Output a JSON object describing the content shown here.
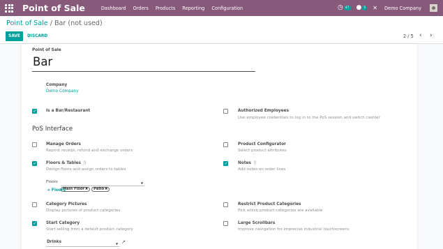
{
  "navbar": {
    "brand": "Point of Sale",
    "menu": [
      "Dashboard",
      "Orders",
      "Products",
      "Reporting",
      "Configuration"
    ],
    "activity_count": "47",
    "message_count": "5",
    "company": "Demo Company",
    "color": "#875a7b"
  },
  "control": {
    "breadcrumb_parent": "Point of Sale",
    "breadcrumb_separator": "/",
    "breadcrumb_current": "Bar (not used)",
    "save_label": "SAVE",
    "discard_label": "DISCARD",
    "pager": "2 / 5",
    "accent": "#00a09d"
  },
  "form": {
    "header_label": "Point of Sale",
    "name": "Bar",
    "company_label": "Company",
    "company_value": "Demo Company",
    "is_bar_label": "Is a Bar/Restaurant",
    "is_bar_checked": true,
    "authorized_label": "Authorized Employees",
    "authorized_help": "Use employee credentials to log in to the PoS session and switch cashier",
    "authorized_checked": false,
    "section_title": "PoS Interface",
    "manage_orders_label": "Manage Orders",
    "manage_orders_help": "Reprint receipt, refund and exchange orders",
    "manage_orders_checked": false,
    "product_config_label": "Product Configurator",
    "product_config_help": "Select product attributes",
    "product_config_checked": false,
    "floors_tables_label": "Floors & Tables",
    "floors_tables_help": "Design floors and assign orders to tables",
    "floors_tables_checked": true,
    "notes_label": "Notes",
    "notes_help": "Add notes on order lines",
    "notes_checked": true,
    "floors_field_label": "Floors",
    "floor_tags": [
      "Main Floor",
      "Patio"
    ],
    "floors_link": "Floors",
    "category_pictures_label": "Category Pictures",
    "category_pictures_help": "Display pictures of product categories",
    "category_pictures_checked": false,
    "restrict_categories_label": "Restrict Product Categories",
    "restrict_categories_help": "Pick which product categories are available",
    "restrict_categories_checked": false,
    "start_category_label": "Start Category",
    "start_category_help": "Start selling from a default product category",
    "start_category_checked": true,
    "large_scrollbars_label": "Large Scrollbars",
    "large_scrollbars_help": "Improve navigation for imprecise industrial touchscreens",
    "large_scrollbars_checked": false,
    "start_category_value": "Drinks"
  }
}
